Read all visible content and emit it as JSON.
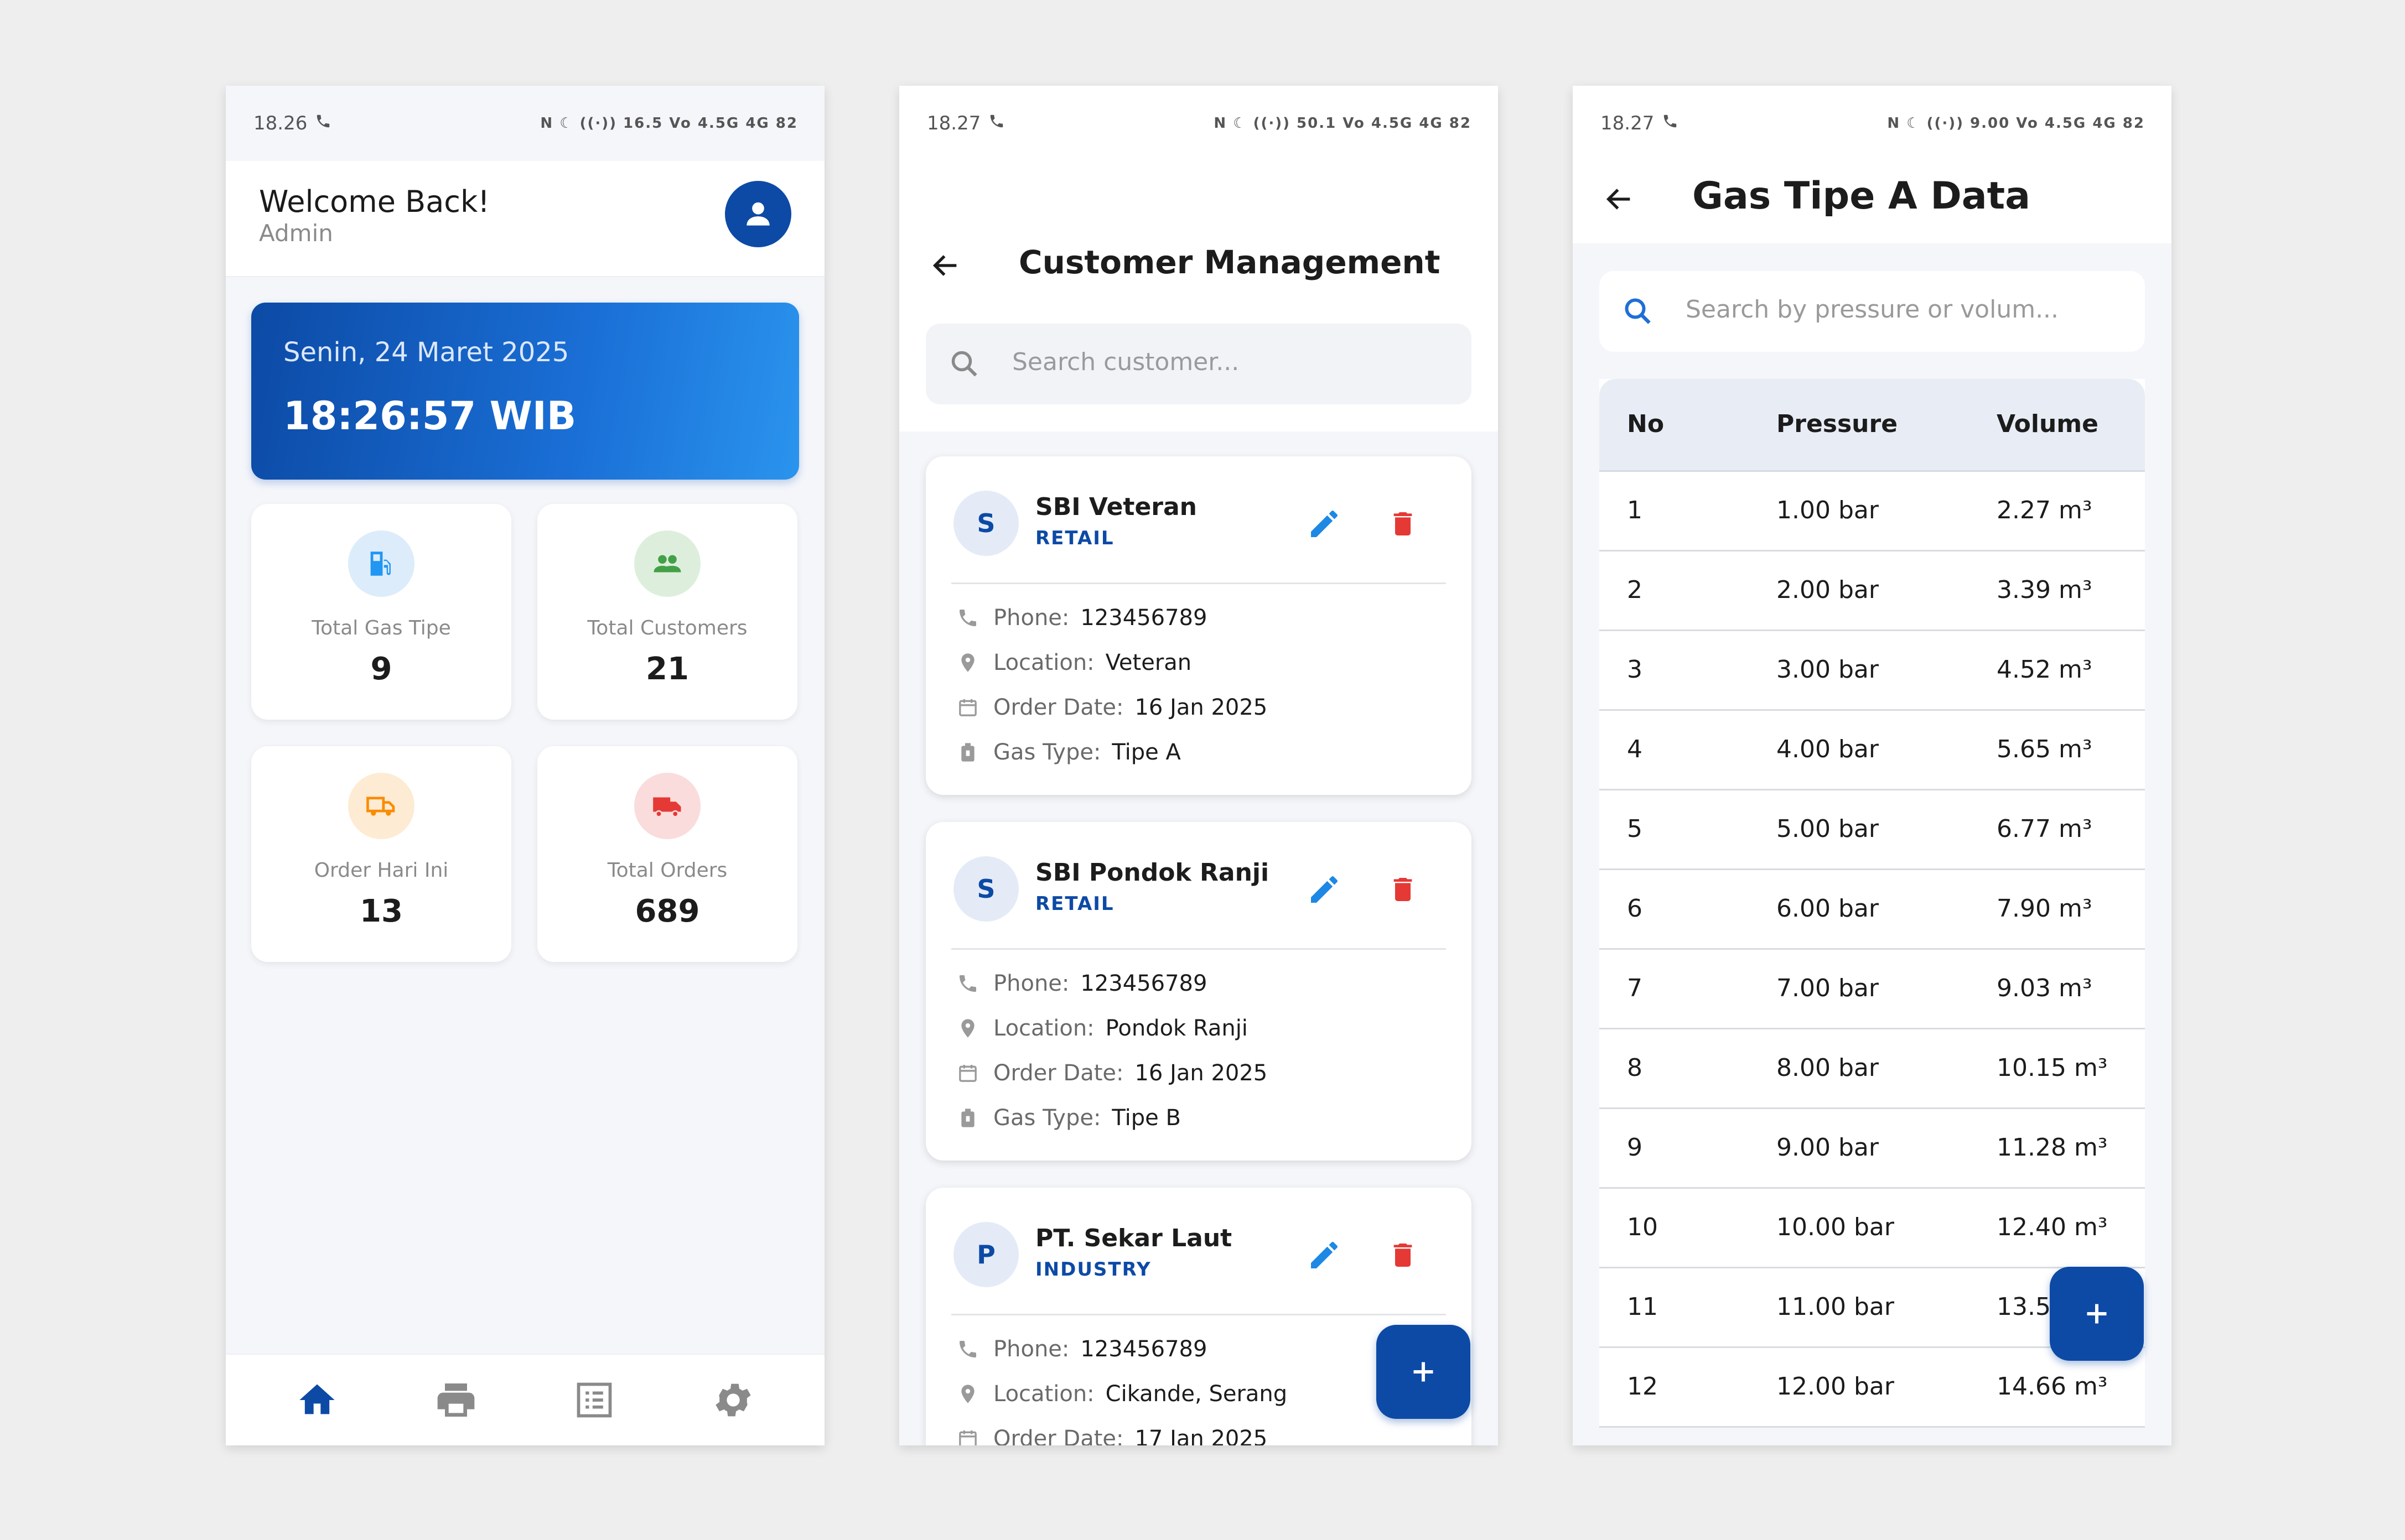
{
  "phone1": {
    "status": {
      "time": "18.26",
      "indicators": "N ☾ ((·)) 16.5 Vo 4.5G 4G 82"
    },
    "header": {
      "title": "Welcome Back!",
      "subtitle": "Admin",
      "avatar_icon": "person-icon"
    },
    "date_card": {
      "date": "Senin, 24 Maret 2025",
      "time": "18:26:57 WIB"
    },
    "stats": [
      {
        "label": "Total Gas Tipe",
        "value": "9",
        "icon": "gas-pump-icon",
        "color": "#2196f3",
        "bg": "#dcecfb"
      },
      {
        "label": "Total Customers",
        "value": "21",
        "icon": "people-icon",
        "color": "#43a047",
        "bg": "#ddefdc"
      },
      {
        "label": "Order Hari Ini",
        "value": "13",
        "icon": "truck-icon",
        "color": "#fb8c00",
        "bg": "#fdebd3"
      },
      {
        "label": "Total Orders",
        "value": "689",
        "icon": "shipping-icon",
        "color": "#e53935",
        "bg": "#fadcdc"
      }
    ],
    "bottom_nav": [
      "home-icon",
      "printer-icon",
      "list-icon",
      "settings-icon"
    ]
  },
  "phone2": {
    "status": {
      "time": "18.27",
      "indicators": "N ☾ ((·)) 50.1 Vo 4.5G 4G 82"
    },
    "title": "Customer Management",
    "search_placeholder": "Search customer...",
    "customers": [
      {
        "initial": "S",
        "name": "SBI Veteran",
        "type": "RETAIL",
        "rows": [
          {
            "icon": "phone-icon",
            "key": "Phone:",
            "value": "123456789"
          },
          {
            "icon": "location-icon",
            "key": "Location:",
            "value": "Veteran"
          },
          {
            "icon": "calendar-icon",
            "key": "Order Date:",
            "value": "16 Jan 2025"
          },
          {
            "icon": "gas-cylinder-icon",
            "key": "Gas Type:",
            "value": "Tipe A"
          }
        ]
      },
      {
        "initial": "S",
        "name": "SBI Pondok Ranji",
        "type": "RETAIL",
        "rows": [
          {
            "icon": "phone-icon",
            "key": "Phone:",
            "value": "123456789"
          },
          {
            "icon": "location-icon",
            "key": "Location:",
            "value": "Pondok Ranji"
          },
          {
            "icon": "calendar-icon",
            "key": "Order Date:",
            "value": "16 Jan 2025"
          },
          {
            "icon": "gas-cylinder-icon",
            "key": "Gas Type:",
            "value": "Tipe B"
          }
        ]
      },
      {
        "initial": "P",
        "name": "PT. Sekar Laut",
        "type": "INDUSTRY",
        "rows": [
          {
            "icon": "phone-icon",
            "key": "Phone:",
            "value": "123456789"
          },
          {
            "icon": "location-icon",
            "key": "Location:",
            "value": "Cikande, Serang"
          },
          {
            "icon": "calendar-icon",
            "key": "Order Date:",
            "value": "17 Jan 2025"
          }
        ]
      }
    ]
  },
  "phone3": {
    "status": {
      "time": "18.27",
      "indicators": "N ☾ ((·)) 9.00 Vo 4.5G 4G 82"
    },
    "title": "Gas Tipe A Data",
    "search_placeholder": "Search by pressure or volum...",
    "columns": [
      "No",
      "Pressure",
      "Volume"
    ],
    "rows": [
      [
        "1",
        "1.00 bar",
        "2.27 m³"
      ],
      [
        "2",
        "2.00 bar",
        "3.39 m³"
      ],
      [
        "3",
        "3.00 bar",
        "4.52 m³"
      ],
      [
        "4",
        "4.00 bar",
        "5.65 m³"
      ],
      [
        "5",
        "5.00 bar",
        "6.77 m³"
      ],
      [
        "6",
        "6.00 bar",
        "7.90 m³"
      ],
      [
        "7",
        "7.00 bar",
        "9.03 m³"
      ],
      [
        "8",
        "8.00 bar",
        "10.15 m³"
      ],
      [
        "9",
        "9.00 bar",
        "11.28 m³"
      ],
      [
        "10",
        "10.00 bar",
        "12.40 m³"
      ],
      [
        "11",
        "11.00 bar",
        "13.53"
      ],
      [
        "12",
        "12.00 bar",
        "14.66 m³"
      ]
    ]
  },
  "fab_label": "+",
  "colors": {
    "primary": "#0d4aa6",
    "delete": "#e53935",
    "edit": "#1e88e5"
  }
}
